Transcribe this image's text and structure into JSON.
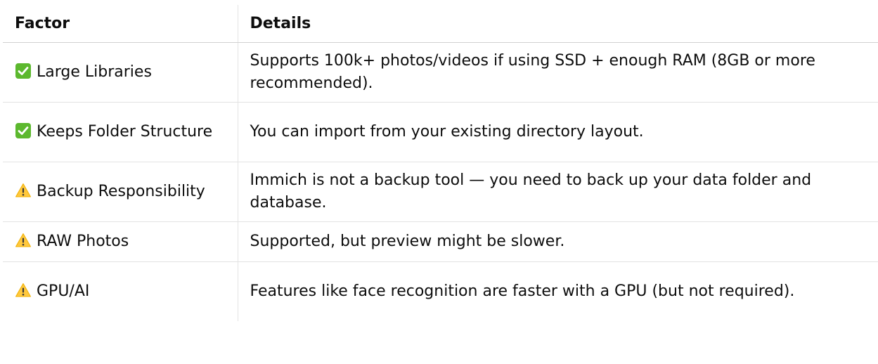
{
  "table": {
    "headers": {
      "factor": "Factor",
      "details": "Details"
    },
    "rows": [
      {
        "icon": "check-mark-button-icon",
        "factor": "Large Libraries",
        "details": "Supports 100k+ photos/videos if using SSD + enough RAM (8GB or more recommended)."
      },
      {
        "icon": "check-mark-button-icon",
        "factor": "Keeps Folder Structure",
        "details": "You can import from your existing directory layout."
      },
      {
        "icon": "warning-icon",
        "factor": "Backup Responsibility",
        "details": "Immich is not a backup tool — you need to back up your data folder and database."
      },
      {
        "icon": "warning-icon",
        "factor": "RAW Photos",
        "details": "Supported, but preview might be slower."
      },
      {
        "icon": "warning-icon",
        "factor": "GPU/AI",
        "details": "Features like face recognition are faster with a GPU (but not required)."
      }
    ]
  },
  "colors": {
    "check_green": "#5cb82e",
    "warning_yellow": "#ffc83d",
    "border": "#e3e3e3"
  }
}
